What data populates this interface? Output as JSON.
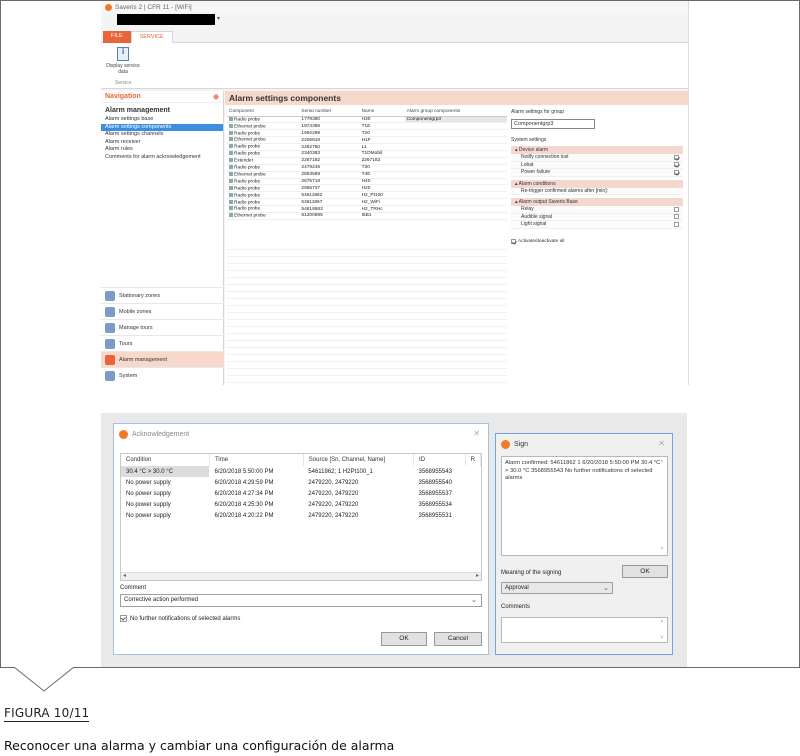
{
  "app": {
    "title": "Saveris 2 | CFR 11 - [WiFi]",
    "redacted_suffix": "▾",
    "tabs": [
      "FILE",
      "SERVICE"
    ],
    "ribbon_button": "Display service data",
    "ribbon_group": "Service",
    "nav_header": "Navigation",
    "nav_pin": "⊕",
    "nav_section": "Alarm management",
    "nav_links": [
      "Alarm settings base",
      "Alarm settings components",
      "Alarm settings channels",
      "Alarm receiver",
      "Alarm rules",
      "Comments for alarm acknowledgement"
    ],
    "nav_buttons": [
      "Stationary zones",
      "Mobile zones",
      "Manage tours",
      "Tours",
      "Alarm management",
      "System"
    ],
    "main_title": "Alarm settings components",
    "grid_headers": [
      "Component",
      "Serial number",
      "Name",
      "Alarm group components"
    ],
    "grid_rows": [
      [
        "Radio probe",
        "1779380",
        "H30",
        "Componentgrp3"
      ],
      [
        "Ethernet probe",
        "1974386",
        "T1E",
        ""
      ],
      [
        "Radio probe",
        "1992289",
        "T20",
        ""
      ],
      [
        "Ethernet probe",
        "2206818",
        "H1F",
        ""
      ],
      [
        "Radio probe",
        "2262760",
        "L1",
        ""
      ],
      [
        "Radio probe",
        "2340383",
        "T1DMobil",
        ""
      ],
      [
        "Extender",
        "2267182",
        "2267182",
        ""
      ],
      [
        "Radio probe",
        "2479245",
        "T30",
        ""
      ],
      [
        "Ethernet probe",
        "2653589",
        "T4E",
        ""
      ],
      [
        "Radio probe",
        "2675718",
        "H40",
        ""
      ],
      [
        "Radio probe",
        "2955737",
        "H20",
        ""
      ],
      [
        "Radio probe",
        "54611862",
        "H2_Pt100",
        ""
      ],
      [
        "Radio probe",
        "54611867",
        "H2_WiFi",
        ""
      ],
      [
        "Radio probe",
        "54619583",
        "H2_TRHc",
        ""
      ],
      [
        "Ethernet probe",
        "61200895",
        "I5B1",
        ""
      ]
    ],
    "settings": {
      "group_label": "Alarm settings for group",
      "group_value": "Componentgrp3",
      "system_label": "System settings",
      "device_alarm": "Device alarm",
      "device_rows": [
        "Notify connection lost",
        "Lobat",
        "Power failure"
      ],
      "conditions": "Alarm conditions",
      "retrigger": "Re-trigger confirmed alarms after [min]:",
      "retrigger_value": "-",
      "output": "Alarm output Saveris Base",
      "output_rows": [
        "Relay",
        "Audible signal",
        "Light signal"
      ],
      "activate": "Activate/deactivate all"
    }
  },
  "ack": {
    "title": "Acknowledgement",
    "close": "✕",
    "headers": [
      "Condition",
      "Time",
      "Source [Sn, Channel, Name]",
      "ID",
      "R"
    ],
    "rows": [
      [
        "30.4 °C > 30.0 °C",
        "6/20/2018 5:50:00 PM",
        "54611862; 1 H2Pt100_1",
        "3568955543"
      ],
      [
        "No power supply",
        "6/20/2018 4:29:59 PM",
        "2479220, 2479220",
        "3568955540"
      ],
      [
        "No power supply",
        "6/20/2018 4:27:34 PM",
        "2479220, 2479220",
        "3568955537"
      ],
      [
        "No power supply",
        "6/20/2018 4:25:30 PM",
        "2479220, 2479220",
        "3568955534"
      ],
      [
        "No power supply",
        "6/20/2018 4:20:22 PM",
        "2479220, 2479220",
        "3568955531"
      ]
    ],
    "scroll_left": "◂",
    "scroll_right": "▸",
    "comment_label": "Comment",
    "comment_value": "Corrective action performed",
    "chevron": "⌄",
    "checkbox_label": "No further notifications of selected alarms",
    "ok": "OK",
    "cancel": "Cancel"
  },
  "sign": {
    "title": "Sign",
    "close": "✕",
    "text": "Alarm confirmed: 54611862 1 6/20/2018 5:50:00 PM 30.4 °C > 30.0 °C 3568955543 No further notifications of selected alarms",
    "meaning_label": "Meaning of the signing",
    "meaning_value": "Approval",
    "ok": "OK",
    "comments_label": "Comments",
    "scroll_up": "˄",
    "scroll_down": "˅"
  },
  "figure": {
    "label": "FIGURA 10/11",
    "caption": "Reconocer una alarma y cambiar una configuración de alarma"
  },
  "colors": {
    "accent": "#e8643a",
    "selection": "#3d8de0",
    "nav_active": "#f7d9cc"
  }
}
